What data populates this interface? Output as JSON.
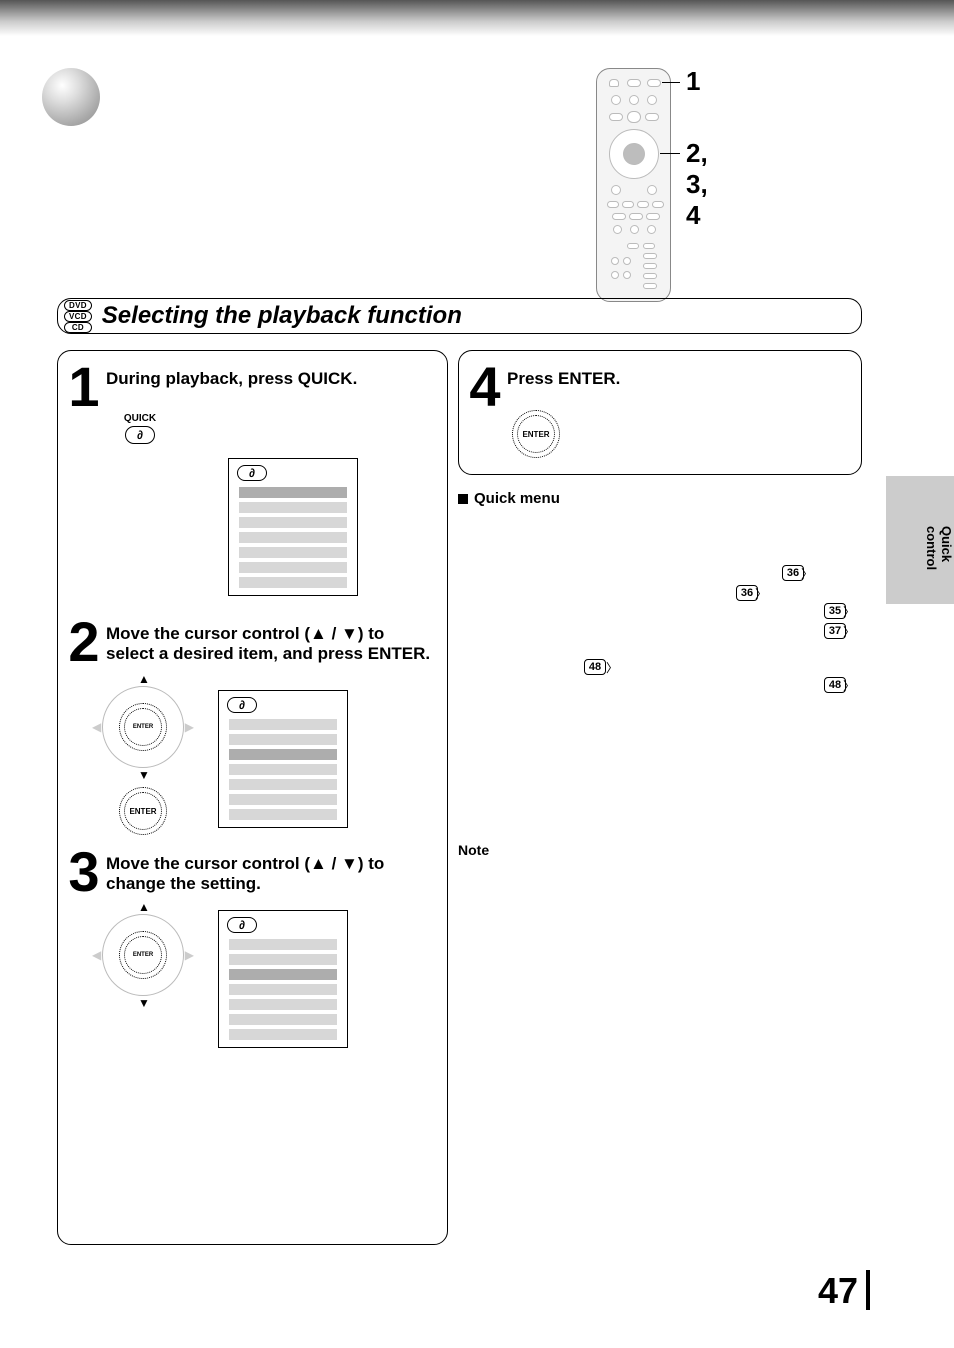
{
  "remote_callouts": {
    "top": "1",
    "middle": "2, 3, 4"
  },
  "disc_badges": [
    "DVD",
    "VCD",
    "CD"
  ],
  "section_title": "Selecting the playback function",
  "steps": {
    "s1": {
      "num": "1",
      "text": "During playback, press QUICK."
    },
    "s2": {
      "num": "2",
      "text": "Move the cursor control (▲ / ▼) to select a desired item, and press ENTER."
    },
    "s3": {
      "num": "3",
      "text": "Move the cursor control (▲ / ▼) to change the setting."
    },
    "s4": {
      "num": "4",
      "text": "Press ENTER."
    }
  },
  "button_labels": {
    "quick": "QUICK",
    "enter": "ENTER"
  },
  "quick_menu": {
    "heading": "Quick menu",
    "refs": {
      "r36a": "36",
      "r36b": "36",
      "r35": "35",
      "r37": "37",
      "r48a": "48",
      "r48b": "48"
    }
  },
  "note": {
    "heading": "Note"
  },
  "side_tab": "Quick control",
  "page_number": "47"
}
